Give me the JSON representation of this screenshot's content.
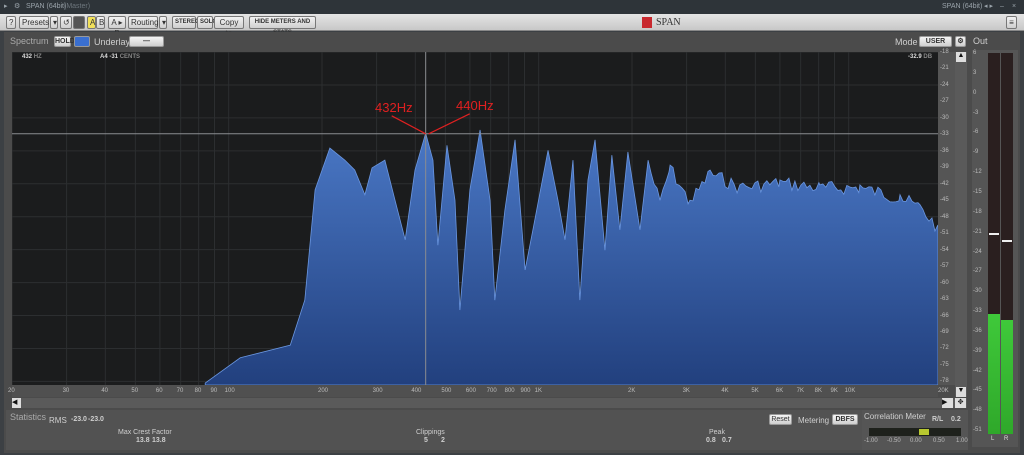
{
  "titlebar": {
    "title": "SPAN (64bit)",
    "subtitle": "(Master)",
    "right_title": "SPAN (64bit)"
  },
  "toolbar": {
    "help": "?",
    "presets": "Presets",
    "a": "A",
    "b": "B",
    "ab": "A ▸ B",
    "routing": "Routing",
    "stereo": "STEREO",
    "solo": "SOLO",
    "copy": "Copy to",
    "hide": "HIDE METERS AND STATS",
    "brand": "SPAN"
  },
  "spectrum": {
    "label": "Spectrum",
    "hold": "HOLD",
    "underlay": "Underlay",
    "underlay_value": "—",
    "mode_label": "Mode",
    "mode_value": "USER",
    "readout_freq": "432",
    "readout_freq_unit": "HZ",
    "readout_note": "A4 -31",
    "readout_note_unit": "CENTS",
    "readout_db": "-32.9",
    "readout_db_unit": "DB",
    "annotation_432": "432Hz",
    "annotation_440": "440Hz",
    "accent": "#3a64b0",
    "annotation_color": "#e02020"
  },
  "chart_data": {
    "type": "area",
    "xscale": "log",
    "xlim": [
      20,
      20000
    ],
    "ylim": [
      -79,
      -17
    ],
    "x_ticks": [
      "20",
      "30",
      "40",
      "50",
      "60",
      "70",
      "80",
      "90",
      "100",
      "200",
      "300",
      "400",
      "500",
      "600",
      "700",
      "800",
      "900",
      "1K",
      "2K",
      "3K",
      "4K",
      "5K",
      "6K",
      "7K",
      "8K",
      "9K",
      "10K",
      "20K"
    ],
    "x_tick_values": [
      20,
      30,
      40,
      50,
      60,
      70,
      80,
      90,
      100,
      200,
      300,
      400,
      500,
      600,
      700,
      800,
      900,
      1000,
      2000,
      3000,
      4000,
      5000,
      6000,
      7000,
      8000,
      9000,
      10000,
      20000
    ],
    "y_ticks": [
      -18,
      -21,
      -24,
      -27,
      -30,
      -33,
      -36,
      -39,
      -42,
      -45,
      -48,
      -51,
      -54,
      -57,
      -60,
      -63,
      -66,
      -69,
      -72,
      -75,
      -78
    ],
    "cursor": {
      "freq": 432,
      "db": -32.9
    },
    "points": [
      [
        84,
        -78.3
      ],
      [
        109,
        -73.7
      ],
      [
        158,
        -71.4
      ],
      [
        176,
        -63.2
      ],
      [
        190,
        -43.1
      ],
      [
        212,
        -35.5
      ],
      [
        237,
        -37.7
      ],
      [
        255,
        -39.5
      ],
      [
        275,
        -44
      ],
      [
        290,
        -39.1
      ],
      [
        319,
        -37.7
      ],
      [
        344,
        -45
      ],
      [
        371,
        -52.2
      ],
      [
        399,
        -39.5
      ],
      [
        432,
        -32.8
      ],
      [
        456,
        -37.7
      ],
      [
        473,
        -53.2
      ],
      [
        506,
        -35
      ],
      [
        537,
        -45
      ],
      [
        557,
        -65
      ],
      [
        600,
        -43.1
      ],
      [
        647,
        -32.2
      ],
      [
        697,
        -45
      ],
      [
        722,
        -63.2
      ],
      [
        778,
        -46.8
      ],
      [
        839,
        -34
      ],
      [
        904,
        -57.7
      ],
      [
        958,
        -50.4
      ],
      [
        1072,
        -35.9
      ],
      [
        1154,
        -45
      ],
      [
        1216,
        -52.2
      ],
      [
        1290,
        -37.7
      ],
      [
        1358,
        -63.2
      ],
      [
        1442,
        -41.3
      ],
      [
        1520,
        -34
      ],
      [
        1636,
        -54.1
      ],
      [
        1722,
        -36.8
      ],
      [
        1828,
        -50.4
      ],
      [
        1940,
        -36.2
      ],
      [
        2122,
        -50.4
      ],
      [
        2254,
        -37.7
      ],
      [
        2462,
        -45
      ],
      [
        2654,
        -38.6
      ],
      [
        3076,
        -45
      ],
      [
        3572,
        -39.5
      ],
      [
        4456,
        -42.2
      ],
      [
        6000,
        -41.3
      ],
      [
        8070,
        -42.2
      ],
      [
        10870,
        -42.2
      ],
      [
        14640,
        -44
      ],
      [
        16980,
        -45.8
      ],
      [
        19400,
        -49.5
      ]
    ]
  },
  "stats": {
    "label": "Statistics",
    "rms_label": "RMS",
    "rms_l": "-23.0",
    "rms_r": "-23.0",
    "crest_label": "Max Crest Factor",
    "crest_l": "13.8",
    "crest_r": "13.8",
    "clip_label": "Clippings",
    "clip_l": "5",
    "clip_r": "2",
    "peak_label": "Peak",
    "peak_l": "0.8",
    "peak_r": "0.7",
    "reset": "Reset",
    "metering_label": "Metering",
    "metering_value": "DBFS"
  },
  "correlation": {
    "label": "Correlation Meter",
    "mode": "R/L",
    "value": "0.2",
    "value_num": 0.2,
    "ticks": [
      "-1.00",
      "-0.50",
      "0.00",
      "0.50",
      "1.00"
    ]
  },
  "out": {
    "label": "Out",
    "ticks": [
      "6",
      "3",
      "0",
      "-3",
      "-6",
      "-9",
      "-12",
      "-15",
      "-18",
      "-21",
      "-24",
      "-27",
      "-30",
      "-33",
      "-36",
      "-39",
      "-42",
      "-45",
      "-48",
      "-51"
    ],
    "channels": [
      "L",
      "R"
    ],
    "level_l_db": -33,
    "level_r_db": -34,
    "peak_l_db": -21,
    "peak_r_db": -22
  }
}
